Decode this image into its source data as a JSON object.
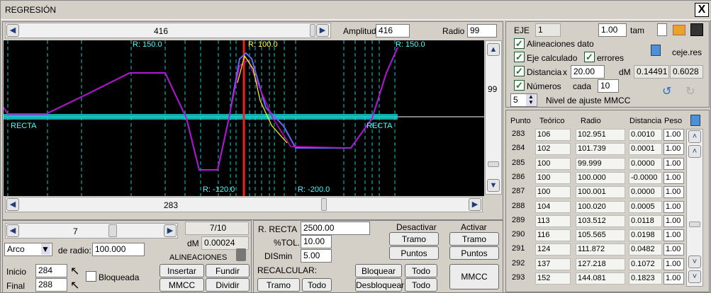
{
  "window": {
    "title": "REGRESIÓN",
    "close_label": "X"
  },
  "top_scroll": {
    "value": "416",
    "amplitud_label": "Amplitud",
    "amplitud_value": "416",
    "radio_label": "Radio",
    "radio_value": "99"
  },
  "plot": {
    "labels": [
      "R: 150.0",
      "R: 100.0",
      "R: 150.0",
      "RECTA",
      "RECTA",
      "R: -120.0",
      "R: -200.0"
    ],
    "side_value": "99"
  },
  "bottom_scroll": {
    "value": "283"
  },
  "lower_left": {
    "slider_value": "7",
    "fraction": "7/10",
    "dm_label": "dM",
    "dm_value": "0.00024",
    "type_select": "Arco",
    "de_radio_label": "de radio:",
    "de_radio_value": "100.000",
    "alineaciones_label": "ALINEACIONES",
    "inicio_label": "Inicio",
    "inicio_value": "284",
    "final_label": "Final",
    "final_value": "288",
    "bloqueada_label": "Bloqueada",
    "insertar": "Insertar",
    "fundir": "Fundir",
    "mmcc": "MMCC",
    "dividir": "Dividir"
  },
  "lower_mid": {
    "r_recta_label": "R. RECTA",
    "r_recta_value": "2500.00",
    "tol_label": "%TOL.",
    "tol_value": "10.00",
    "dismin_label": "DISmin",
    "dismin_value": "5.00",
    "recalcular_label": "RECALCULAR:",
    "tramo": "Tramo",
    "todo": "Todo",
    "desactivar_label": "Desactivar",
    "activar_label": "Activar",
    "d_tramo": "Tramo",
    "d_puntos": "Puntos",
    "a_tramo": "Tramo",
    "a_puntos": "Puntos",
    "bloquear": "Bloquear",
    "bloquear_todo": "Todo",
    "desbloquear": "Desbloquear",
    "desbloquear_todo": "Todo",
    "mmcc": "MMCC"
  },
  "right_top": {
    "eje_label": "EJE",
    "eje_value": "1",
    "tam_value": "1.00",
    "tam_label": "tam",
    "alineaciones_dato": "Alineaciones dato",
    "eje_calculado": "Eje calculado",
    "errores": "errores",
    "ceje_label": "ceje.res",
    "distancia_label": "Distancia",
    "x_label": "x",
    "x_value": "20.00",
    "dm_label": "dM",
    "dm_value1": "0.14491",
    "dm_value2": "0.6028",
    "numeros_label": "Números",
    "cada_label": "cada",
    "cada_value": "10",
    "nivel_value": "5",
    "nivel_label": "Nivel de ajuste MMCC"
  },
  "table": {
    "headers": [
      "Punto",
      "Teórico",
      "Radio",
      "Distancia",
      "Peso"
    ],
    "rows": [
      [
        "283",
        "106",
        "102.951",
        "0.0010",
        "1.00"
      ],
      [
        "284",
        "102",
        "101.739",
        "0.0001",
        "1.00"
      ],
      [
        "285",
        "100",
        "99.999",
        "0.0000",
        "1.00"
      ],
      [
        "286",
        "100",
        "100.000",
        "-0.0000",
        "1.00"
      ],
      [
        "287",
        "100",
        "100.001",
        "0.0000",
        "1.00"
      ],
      [
        "288",
        "104",
        "100.020",
        "0.0005",
        "1.00"
      ],
      [
        "289",
        "113",
        "103.512",
        "0.0118",
        "1.00"
      ],
      [
        "290",
        "116",
        "105.565",
        "0.0198",
        "1.00"
      ],
      [
        "291",
        "124",
        "111.872",
        "0.0482",
        "1.00"
      ],
      [
        "292",
        "137",
        "127.218",
        "0.1072",
        "1.00"
      ],
      [
        "293",
        "152",
        "144.081",
        "0.1823",
        "1.00"
      ]
    ]
  }
}
